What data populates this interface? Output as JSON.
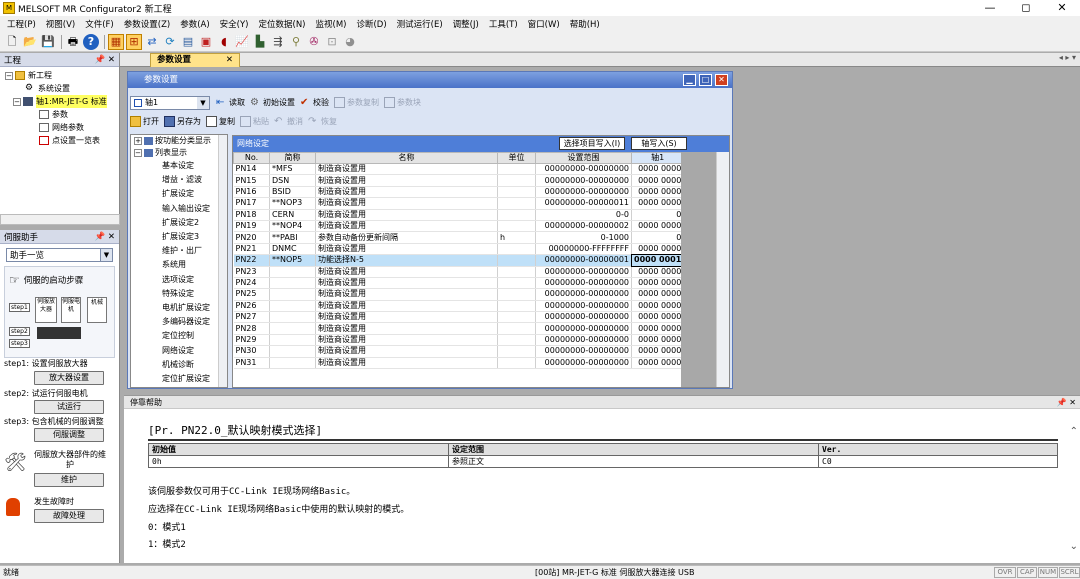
{
  "app": {
    "title": "MELSOFT MR Configurator2 新工程",
    "icon": "app-icon",
    "controls": [
      "—",
      "◻",
      "✕"
    ]
  },
  "menu": [
    "工程(P)",
    "视图(V)",
    "文件(F)",
    "参数设置(Z)",
    "参数(A)",
    "安全(Y)",
    "定位数据(N)",
    "监视(M)",
    "诊断(D)",
    "测试运行(E)",
    "调整(J)",
    "工具(T)",
    "窗口(W)",
    "帮助(H)"
  ],
  "project_panel": {
    "title": "工程",
    "pin": "📌 ✕",
    "tree": [
      "新工程",
      "系统设置",
      "轴1:MR-JET-G 标准",
      "参数",
      "网络参数",
      "点设置一览表"
    ]
  },
  "assist_panel": {
    "title": "伺服助手",
    "pin": "📌 ✕",
    "combo": "助手一览",
    "startup_title": "伺服的启动步骤",
    "diagram": {
      "step1": "step1",
      "step2": "step2",
      "step3": "step3",
      "amp": "伺服放大器",
      "motor": "伺服电机",
      "machine": "机械"
    },
    "steps": [
      {
        "label": "step1: 设置伺服放大器",
        "button": "放大器设置"
      },
      {
        "label": "step2: 试运行伺服电机",
        "button": "试运行"
      },
      {
        "label": "step3: 包含机械的伺服调整",
        "button": "伺服调整"
      }
    ],
    "maintenance": {
      "label": "伺服放大器部件的维护",
      "button": "维护"
    },
    "alarm": {
      "label": "发生故障时",
      "button": "故障处理"
    }
  },
  "doc_tab": {
    "label": "参数设置",
    "close": "✕",
    "nav": "◂ ▸ ▾"
  },
  "param_window": {
    "title": "参数设置",
    "axis_select": "轴1",
    "toolbar1": [
      "读取",
      "初始设置",
      "校验",
      "参数复制",
      "参数块"
    ],
    "toolbar2": [
      "打开",
      "另存为",
      "复制",
      "粘贴",
      "撤消",
      "恢复"
    ],
    "tree_groups": [
      "按功能分类显示",
      "列表显示"
    ],
    "tree_items": [
      "基本设定",
      "增益・滤波",
      "扩展设定",
      "输入输出设定",
      "扩展设定2",
      "扩展设定3",
      "维护・出厂",
      "系统用",
      "选项设定",
      "特殊设定",
      "电机扩展设定",
      "多编码器设定",
      "定位控制",
      "网络设定",
      "机械诊断",
      "定位扩展设定"
    ],
    "grid": {
      "title": "网络设定",
      "btn_select": "选择项目写入(I)",
      "btn_axis": "轴写入(S)",
      "headers": [
        "No.",
        "简称",
        "名称",
        "单位",
        "设置范围",
        "轴1"
      ],
      "rows": [
        [
          "PN14",
          "*MFS",
          "制造商设置用",
          "",
          "00000000-00000000",
          "0000 0000"
        ],
        [
          "PN15",
          "DSN",
          "制造商设置用",
          "",
          "00000000-00000000",
          "0000 0000"
        ],
        [
          "PN16",
          "BSID",
          "制造商设置用",
          "",
          "00000000-00000000",
          "0000 0000"
        ],
        [
          "PN17",
          "**NOP3",
          "制造商设置用",
          "",
          "00000000-00000011",
          "0000 0000"
        ],
        [
          "PN18",
          "CERN",
          "制造商设置用",
          "",
          "0-0",
          "0"
        ],
        [
          "PN19",
          "**NOP4",
          "制造商设置用",
          "",
          "00000000-00000002",
          "0000 0000"
        ],
        [
          "PN20",
          "**PABI",
          "参数自动备份更新间隔",
          "h",
          "0-1000",
          "0"
        ],
        [
          "PN21",
          "DNMC",
          "制造商设置用",
          "",
          "00000000-FFFFFFFF",
          "0000 0000"
        ],
        [
          "PN22",
          "**NOP5",
          "功能选择N-5",
          "",
          "00000000-00000001",
          "0000 0001"
        ],
        [
          "PN23",
          "",
          "制造商设置用",
          "",
          "00000000-00000000",
          "0000 0000"
        ],
        [
          "PN24",
          "",
          "制造商设置用",
          "",
          "00000000-00000000",
          "0000 0000"
        ],
        [
          "PN25",
          "",
          "制造商设置用",
          "",
          "00000000-00000000",
          "0000 0000"
        ],
        [
          "PN26",
          "",
          "制造商设置用",
          "",
          "00000000-00000000",
          "0000 0000"
        ],
        [
          "PN27",
          "",
          "制造商设置用",
          "",
          "00000000-00000000",
          "0000 0000"
        ],
        [
          "PN28",
          "",
          "制造商设置用",
          "",
          "00000000-00000000",
          "0000 0000"
        ],
        [
          "PN29",
          "",
          "制造商设置用",
          "",
          "00000000-00000000",
          "0000 0000"
        ],
        [
          "PN30",
          "",
          "制造商设置用",
          "",
          "00000000-00000000",
          "0000 0000"
        ],
        [
          "PN31",
          "",
          "制造商设置用",
          "",
          "00000000-00000000",
          "0000 0000"
        ]
      ]
    }
  },
  "help": {
    "panel_title": "停靠帮助",
    "pin": "📌 ✕",
    "title": "[Pr. PN22.0_默认映射模式选择]",
    "table_headers": [
      "初始值",
      "设定范围",
      "Ver."
    ],
    "table_values": [
      "0h",
      "参照正文",
      "C0"
    ],
    "lines": [
      "该伺服参数仅可用于CC-Link IE现场网络Basic。",
      "应选择在CC-Link IE现场网络Basic中使用的默认映射的模式。",
      "0：模式1",
      "1：模式2"
    ]
  },
  "status": {
    "left": "就绪",
    "center": "[00站] MR-JET-G 标准 伺服放大器连接 USB",
    "indicators": [
      "OVR",
      "CAP",
      "NUM",
      "SCRL"
    ]
  },
  "colors": {
    "accent_blue": "#4e7ed8",
    "selected_row": "#bfe0f8",
    "tab_yellow": "#ffe38a",
    "highlight": "#ffd060"
  }
}
